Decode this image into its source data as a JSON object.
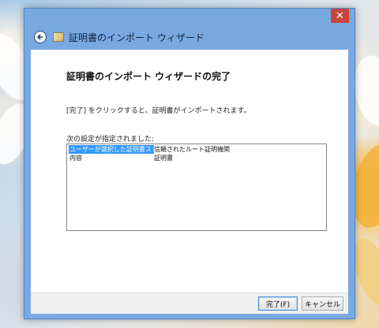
{
  "window": {
    "title": "証明書のインポート ウィザード",
    "close_label": "✕"
  },
  "content": {
    "heading": "証明書のインポート ウィザードの完了",
    "description": "[完了] をクリックすると、証明書がインポートされます。",
    "settings_label": "次の設定が指定されました:",
    "settings": [
      {
        "key": "ユーザーが選択した証明書ストア",
        "value": "信頼されたルート証明機関",
        "selected": true
      },
      {
        "key": "内容",
        "value": "証明書",
        "selected": false
      }
    ]
  },
  "footer": {
    "finish_label": "完了(F)",
    "cancel_label": "キャンセル"
  },
  "colors": {
    "accent": "#3399ff",
    "titlebar": "#78a9e0",
    "close": "#c7463b"
  },
  "icons": {
    "back": "back-arrow-icon",
    "wizard": "certificate-wizard-icon"
  }
}
